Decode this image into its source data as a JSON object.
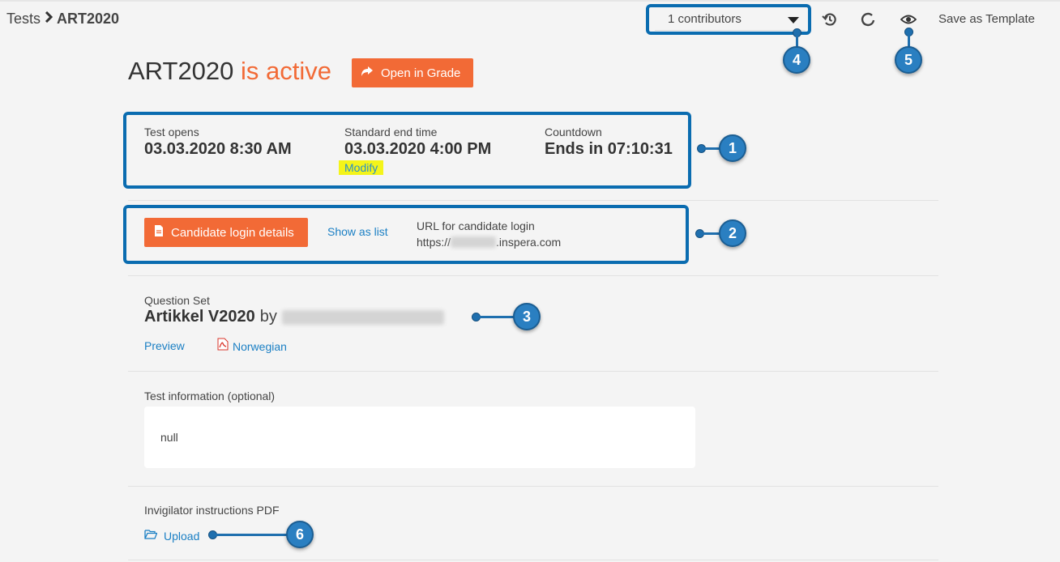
{
  "breadcrumb": {
    "root": "Tests",
    "current": "ART2020"
  },
  "header": {
    "contributors": "1 contributors",
    "save_template": "Save as Template"
  },
  "title": {
    "name": "ART2020",
    "status": "is active"
  },
  "open_grade": "Open in Grade",
  "schedule": {
    "opens_label": "Test opens",
    "opens_value": "03.03.2020 8:30 AM",
    "end_label": "Standard end time",
    "end_value": "03.03.2020 4:00 PM",
    "modify": "Modify",
    "countdown_label": "Countdown",
    "countdown_value": "Ends in 07:10:31"
  },
  "login": {
    "button": "Candidate login details",
    "show_list": "Show as list",
    "url_label": "URL for candidate login",
    "url_prefix": "https://",
    "url_suffix": ".inspera.com"
  },
  "question_set": {
    "label": "Question Set",
    "name": "Artikkel V2020",
    "by": "by",
    "preview": "Preview",
    "norwegian": "Norwegian"
  },
  "test_info": {
    "label": "Test information (optional)",
    "value": "null"
  },
  "invigilator": {
    "label": "Invigilator instructions PDF",
    "upload": "Upload"
  },
  "callouts": [
    "1",
    "2",
    "3",
    "4",
    "5",
    "6"
  ],
  "colors": {
    "accent": "#f26a36",
    "link": "#1a7fc4",
    "callout": "#0a6cb0"
  }
}
